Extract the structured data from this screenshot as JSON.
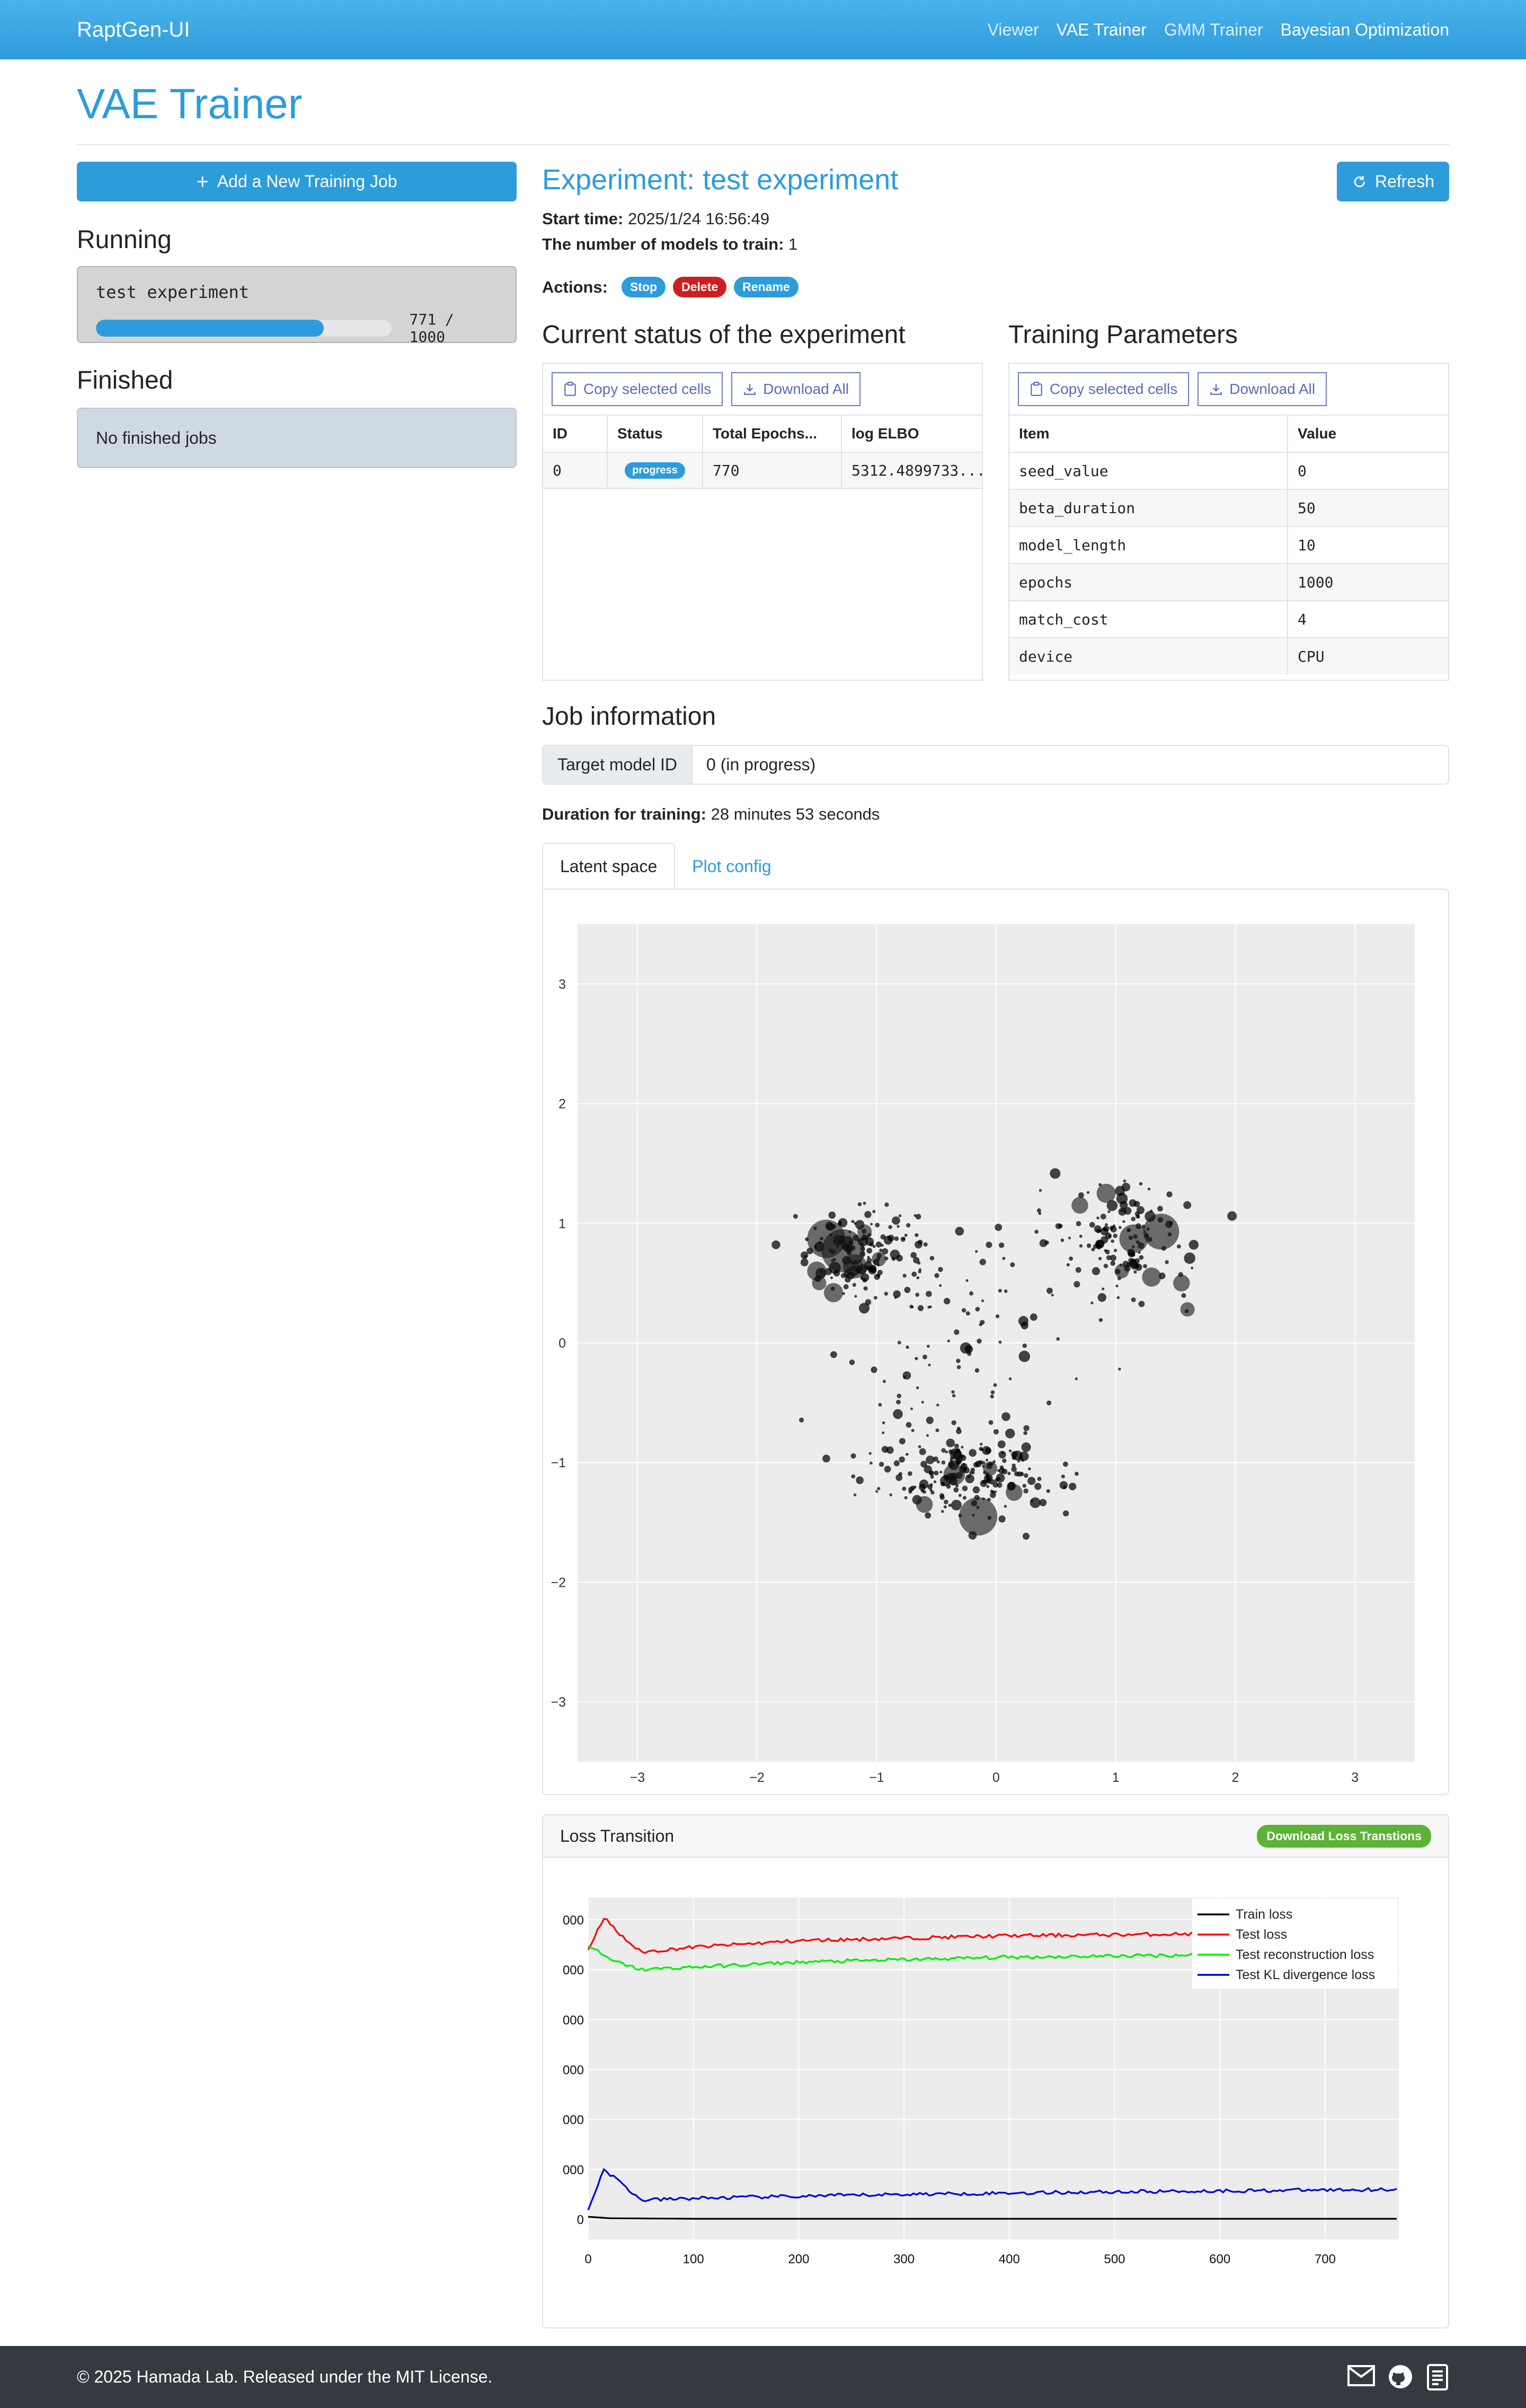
{
  "nav": {
    "brand": "RaptGen-UI",
    "links": [
      "Viewer",
      "VAE Trainer",
      "GMM Trainer",
      "Bayesian Optimization"
    ],
    "active": "VAE Trainer"
  },
  "page": {
    "title": "VAE Trainer"
  },
  "sidebar": {
    "add_job_label": "Add a New Training Job",
    "running_heading": "Running",
    "running_jobs": [
      {
        "name": "test experiment",
        "progress_text": "771 / 1000",
        "progress": 0.771
      }
    ],
    "finished_heading": "Finished",
    "finished_empty": "No finished jobs"
  },
  "experiment": {
    "title": "Experiment: test experiment",
    "refresh_label": "Refresh",
    "start_time_label": "Start time:",
    "start_time": "2025/1/24 16:56:49",
    "num_models_label": "The number of models to train:",
    "num_models": "1",
    "actions_label": "Actions:",
    "actions": {
      "stop": "Stop",
      "delete": "Delete",
      "rename": "Rename"
    }
  },
  "status": {
    "heading": "Current status of the experiment",
    "copy_label": "Copy selected cells",
    "download_label": "Download All",
    "columns": [
      "ID",
      "Status",
      "Total Epochs...",
      "log ELBO"
    ],
    "rows": [
      {
        "id": "0",
        "status": "progress",
        "epochs": "770",
        "elbo": "5312.4899733..."
      }
    ]
  },
  "params": {
    "heading": "Training Parameters",
    "copy_label": "Copy selected cells",
    "download_label": "Download All",
    "columns": [
      "Item",
      "Value"
    ],
    "rows": [
      {
        "item": "seed_value",
        "value": "0"
      },
      {
        "item": "beta_duration",
        "value": "50"
      },
      {
        "item": "model_length",
        "value": "10"
      },
      {
        "item": "epochs",
        "value": "1000"
      },
      {
        "item": "match_cost",
        "value": "4"
      },
      {
        "item": "device",
        "value": "CPU"
      }
    ]
  },
  "jobinfo": {
    "heading": "Job information",
    "target_label": "Target model ID",
    "target_value": "0 (in progress)",
    "duration_label": "Duration for training:",
    "duration": "28 minutes 53 seconds"
  },
  "tabs": [
    "Latent space",
    "Plot config"
  ],
  "chart_data": [
    {
      "type": "scatter",
      "title": "",
      "xlabel": "",
      "ylabel": "",
      "xlim": [
        -3.5,
        3.5
      ],
      "ylim": [
        -3.5,
        3.5
      ],
      "xticks": [
        "−3",
        "−2",
        "−1",
        "0",
        "1",
        "2",
        "3"
      ],
      "yticks": [
        "3",
        "2",
        "1",
        "0",
        "−1",
        "−2",
        "−3"
      ],
      "grid": true,
      "clusters": [
        {
          "cx": -1.15,
          "cy": 0.75,
          "sx": 0.28,
          "sy": 0.18,
          "n": 140
        },
        {
          "cx": 1.05,
          "cy": 0.85,
          "sx": 0.3,
          "sy": 0.25,
          "n": 140
        },
        {
          "cx": -0.2,
          "cy": -1.1,
          "sx": 0.38,
          "sy": 0.16,
          "n": 190
        },
        {
          "cx": -0.45,
          "cy": 0.0,
          "sx": 0.45,
          "sy": 0.6,
          "n": 110
        }
      ],
      "large_points": [
        {
          "x": -1.42,
          "y": 0.87,
          "r": 0.16
        },
        {
          "x": -1.28,
          "y": 0.77,
          "r": 0.18
        },
        {
          "x": -1.5,
          "y": 0.6,
          "r": 0.08
        },
        {
          "x": -1.36,
          "y": 0.42,
          "r": 0.08
        },
        {
          "x": -1.48,
          "y": 0.5,
          "r": 0.06
        },
        {
          "x": -1.18,
          "y": 0.64,
          "r": 0.1
        },
        {
          "x": -1.1,
          "y": 0.93,
          "r": 0.06
        },
        {
          "x": -0.98,
          "y": 0.7,
          "r": 0.06
        },
        {
          "x": 1.38,
          "y": 0.93,
          "r": 0.15
        },
        {
          "x": 1.15,
          "y": 0.87,
          "r": 0.12
        },
        {
          "x": 0.92,
          "y": 1.25,
          "r": 0.08
        },
        {
          "x": 0.7,
          "y": 1.15,
          "r": 0.07
        },
        {
          "x": 1.55,
          "y": 0.5,
          "r": 0.07
        },
        {
          "x": 1.6,
          "y": 0.28,
          "r": 0.06
        },
        {
          "x": 1.3,
          "y": 0.55,
          "r": 0.08
        },
        {
          "x": 1.05,
          "y": 0.6,
          "r": 0.06
        },
        {
          "x": -0.15,
          "y": -1.45,
          "r": 0.16
        },
        {
          "x": -0.6,
          "y": -1.35,
          "r": 0.07
        },
        {
          "x": 0.15,
          "y": -1.25,
          "r": 0.07
        },
        {
          "x": -0.35,
          "y": -1.1,
          "r": 0.09
        },
        {
          "x": -0.05,
          "y": -1.05,
          "r": 0.06
        }
      ]
    },
    {
      "type": "line",
      "title": "Loss Transition",
      "download_label": "Download Loss Transtions",
      "x_range": [
        0,
        770
      ],
      "xticks": [
        0,
        100,
        200,
        300,
        400,
        500,
        600,
        700
      ],
      "yticks": [
        "000",
        "000",
        "000",
        "000",
        "000",
        "000",
        "0"
      ],
      "grid": true,
      "legend_position": "top-right",
      "series": [
        {
          "name": "Train loss",
          "color": "#000000",
          "points": [
            [
              0,
              0.05
            ],
            [
              20,
              0.02
            ],
            [
              100,
              0.01
            ],
            [
              770,
              0.01
            ]
          ]
        },
        {
          "name": "Test loss",
          "color": "#ff0000",
          "points": [
            [
              0,
              5.4
            ],
            [
              15,
              6.05
            ],
            [
              30,
              5.7
            ],
            [
              50,
              5.35
            ],
            [
              100,
              5.45
            ],
            [
              200,
              5.58
            ],
            [
              400,
              5.68
            ],
            [
              600,
              5.72
            ],
            [
              770,
              5.78
            ]
          ]
        },
        {
          "name": "Test reconstruction loss",
          "color": "#00ee00",
          "points": [
            [
              0,
              5.5
            ],
            [
              20,
              5.2
            ],
            [
              50,
              5.0
            ],
            [
              100,
              5.05
            ],
            [
              200,
              5.15
            ],
            [
              400,
              5.25
            ],
            [
              600,
              5.3
            ],
            [
              770,
              5.34
            ]
          ]
        },
        {
          "name": "Test KL divergence loss",
          "color": "#0000dd",
          "points": [
            [
              0,
              0.2
            ],
            [
              15,
              1.0
            ],
            [
              30,
              0.75
            ],
            [
              50,
              0.38
            ],
            [
              100,
              0.42
            ],
            [
              300,
              0.5
            ],
            [
              500,
              0.55
            ],
            [
              770,
              0.6
            ]
          ]
        }
      ]
    }
  ],
  "footer": {
    "text": "© 2025 Hamada Lab. Released under the MIT License."
  },
  "colors": {
    "primary": "#2d9cdb",
    "stop": "#2d9cdb",
    "delete": "#cc1f1f",
    "rename": "#2d9cdb",
    "progress_badge": "#2d9cdb",
    "download_loss": "#5cb336"
  }
}
